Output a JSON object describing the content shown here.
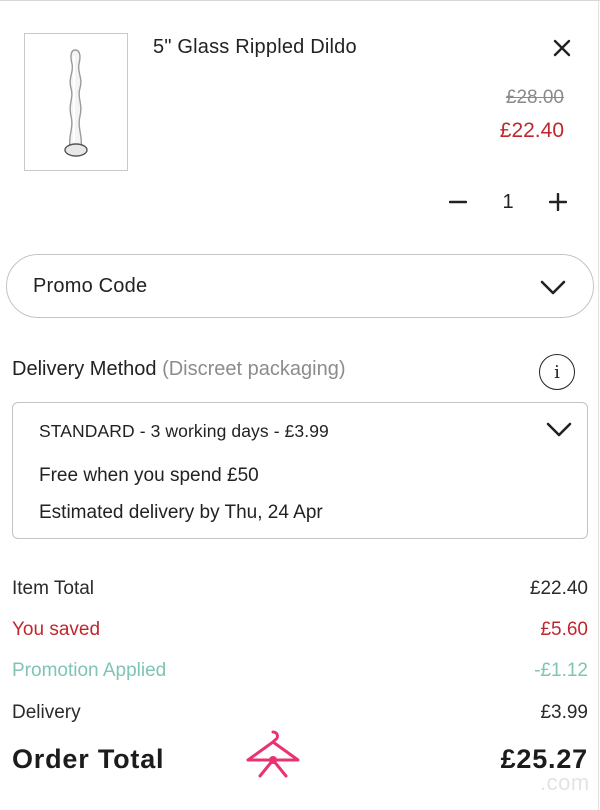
{
  "cart_item": {
    "title": "5\" Glass Rippled Dildo",
    "old_price": "£28.00",
    "price": "£22.40",
    "quantity": "1",
    "image_icon": "glass-product-image"
  },
  "promo": {
    "label": "Promo Code"
  },
  "delivery": {
    "heading": "Delivery Method",
    "subheading": "(Discreet packaging)",
    "info_label": "i",
    "selected_option": "STANDARD - 3 working days - £3.99",
    "free_note": "Free when you spend £50",
    "estimate": "Estimated delivery by Thu, 24 Apr"
  },
  "summary": {
    "item_total_label": "Item Total",
    "item_total_value": "£22.40",
    "saved_label": "You saved",
    "saved_value": "£5.60",
    "promo_label": "Promotion Applied",
    "promo_value": "-£1.12",
    "delivery_label": "Delivery",
    "delivery_value": "£3.99",
    "order_total_label": "Order Total",
    "order_total_value": "£25.27"
  },
  "watermark": {
    "text": ".com",
    "icon": "hanger-bow-logo"
  },
  "colors": {
    "sale_red": "#c0272d",
    "promo_teal": "#7fc4b5",
    "logo_pink": "#e8336f",
    "border_grey": "#c4c4c4"
  }
}
